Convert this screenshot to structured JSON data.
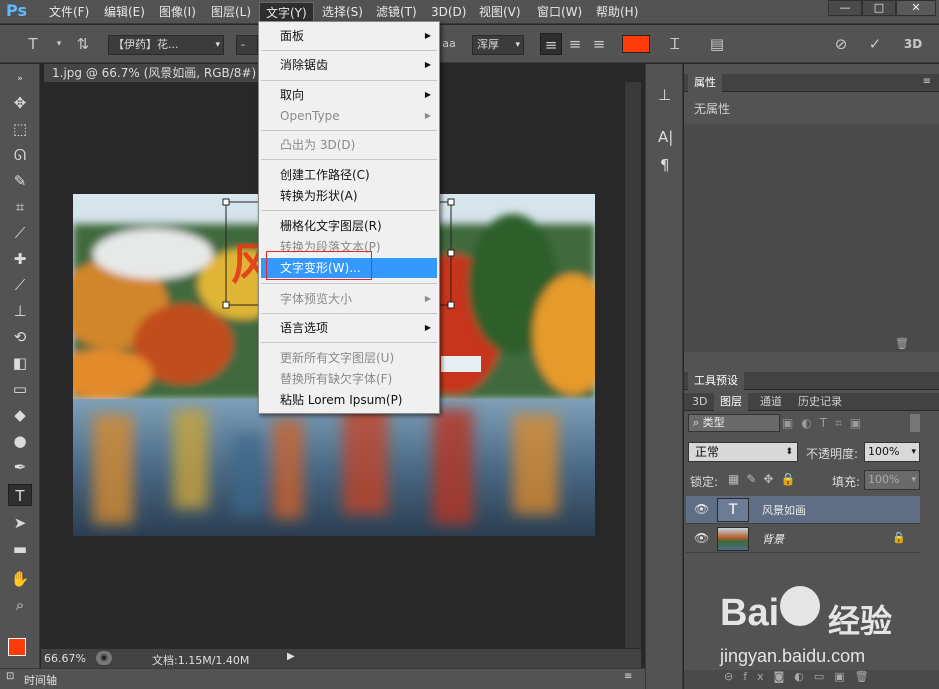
{
  "menubar": {
    "logo": "Ps",
    "items": [
      {
        "label": "文件(F)"
      },
      {
        "label": "编辑(E)"
      },
      {
        "label": "图像(I)"
      },
      {
        "label": "图层(L)"
      },
      {
        "label": "文字(Y)"
      },
      {
        "label": "选择(S)"
      },
      {
        "label": "滤镜(T)"
      },
      {
        "label": "3D(D)"
      },
      {
        "label": "视图(V)"
      },
      {
        "label": "窗口(W)"
      },
      {
        "label": "帮助(H)"
      }
    ],
    "window_buttons": {
      "minimize": "—",
      "restore": "□",
      "close": "✕"
    }
  },
  "options_bar": {
    "font_family": "【伊药】花...",
    "font_style": "-",
    "aa_label": "aa",
    "anti_alias": "浑厚",
    "color": "#ff3b0a",
    "three_d": "3D"
  },
  "document": {
    "tab_title": "1.jpg @ 66.7% (风景如画, RGB/8#) *",
    "zoom": "66.67%",
    "doc_size": "文档:1.15M/1.40M",
    "overlay_letter": "风"
  },
  "timeline": {
    "label": "时间轴"
  },
  "text_menu": {
    "items": [
      {
        "label": "面板",
        "submenu": true,
        "disabled": false
      },
      {
        "label": "消除锯齿",
        "submenu": true,
        "disabled": false
      },
      {
        "label": "取向",
        "submenu": true,
        "disabled": false
      },
      {
        "label": "OpenType",
        "submenu": true,
        "disabled": true
      },
      {
        "label": "凸出为 3D(D)",
        "submenu": false,
        "disabled": true
      },
      {
        "label": "创建工作路径(C)",
        "submenu": false,
        "disabled": false
      },
      {
        "label": "转换为形状(A)",
        "submenu": false,
        "disabled": false
      },
      {
        "label": "栅格化文字图层(R)",
        "submenu": false,
        "disabled": false
      },
      {
        "label": "转换为段落文本(P)",
        "submenu": false,
        "disabled": true
      },
      {
        "label": "文字变形(W)...",
        "submenu": false,
        "disabled": false,
        "highlighted": true
      },
      {
        "label": "字体预览大小",
        "submenu": true,
        "disabled": true
      },
      {
        "label": "语言选项",
        "submenu": true,
        "disabled": false
      },
      {
        "label": "更新所有文字图层(U)",
        "submenu": false,
        "disabled": true
      },
      {
        "label": "替换所有缺欠字体(F)",
        "submenu": false,
        "disabled": true
      },
      {
        "label": "粘贴 Lorem Ipsum(P)",
        "submenu": false,
        "disabled": false
      }
    ]
  },
  "properties_panel": {
    "tab": "属性",
    "empty_text": "无属性"
  },
  "tool_presets_panel": {
    "tab": "工具预设"
  },
  "layers_panel": {
    "tabs": [
      "3D",
      "图层",
      "通道",
      "历史记录"
    ],
    "filter_label": "类型",
    "blend_mode": "正常",
    "opacity_label": "不透明度:",
    "opacity_value": "100%",
    "lock_label": "锁定:",
    "fill_label": "填充:",
    "fill_value": "100%",
    "layers": [
      {
        "name": "风景如画",
        "type": "text",
        "thumb_glyph": "T",
        "selected": true
      },
      {
        "name": "背景",
        "type": "image",
        "selected": false
      }
    ]
  },
  "watermark": {
    "brand": "Bai",
    "brand2": "经验",
    "url": "jingyan.baidu.com"
  },
  "colors": {
    "foreground": "#ff3b0a",
    "background": "#ffffff",
    "highlight": "#3399ff",
    "annotation": "#e0262a"
  }
}
